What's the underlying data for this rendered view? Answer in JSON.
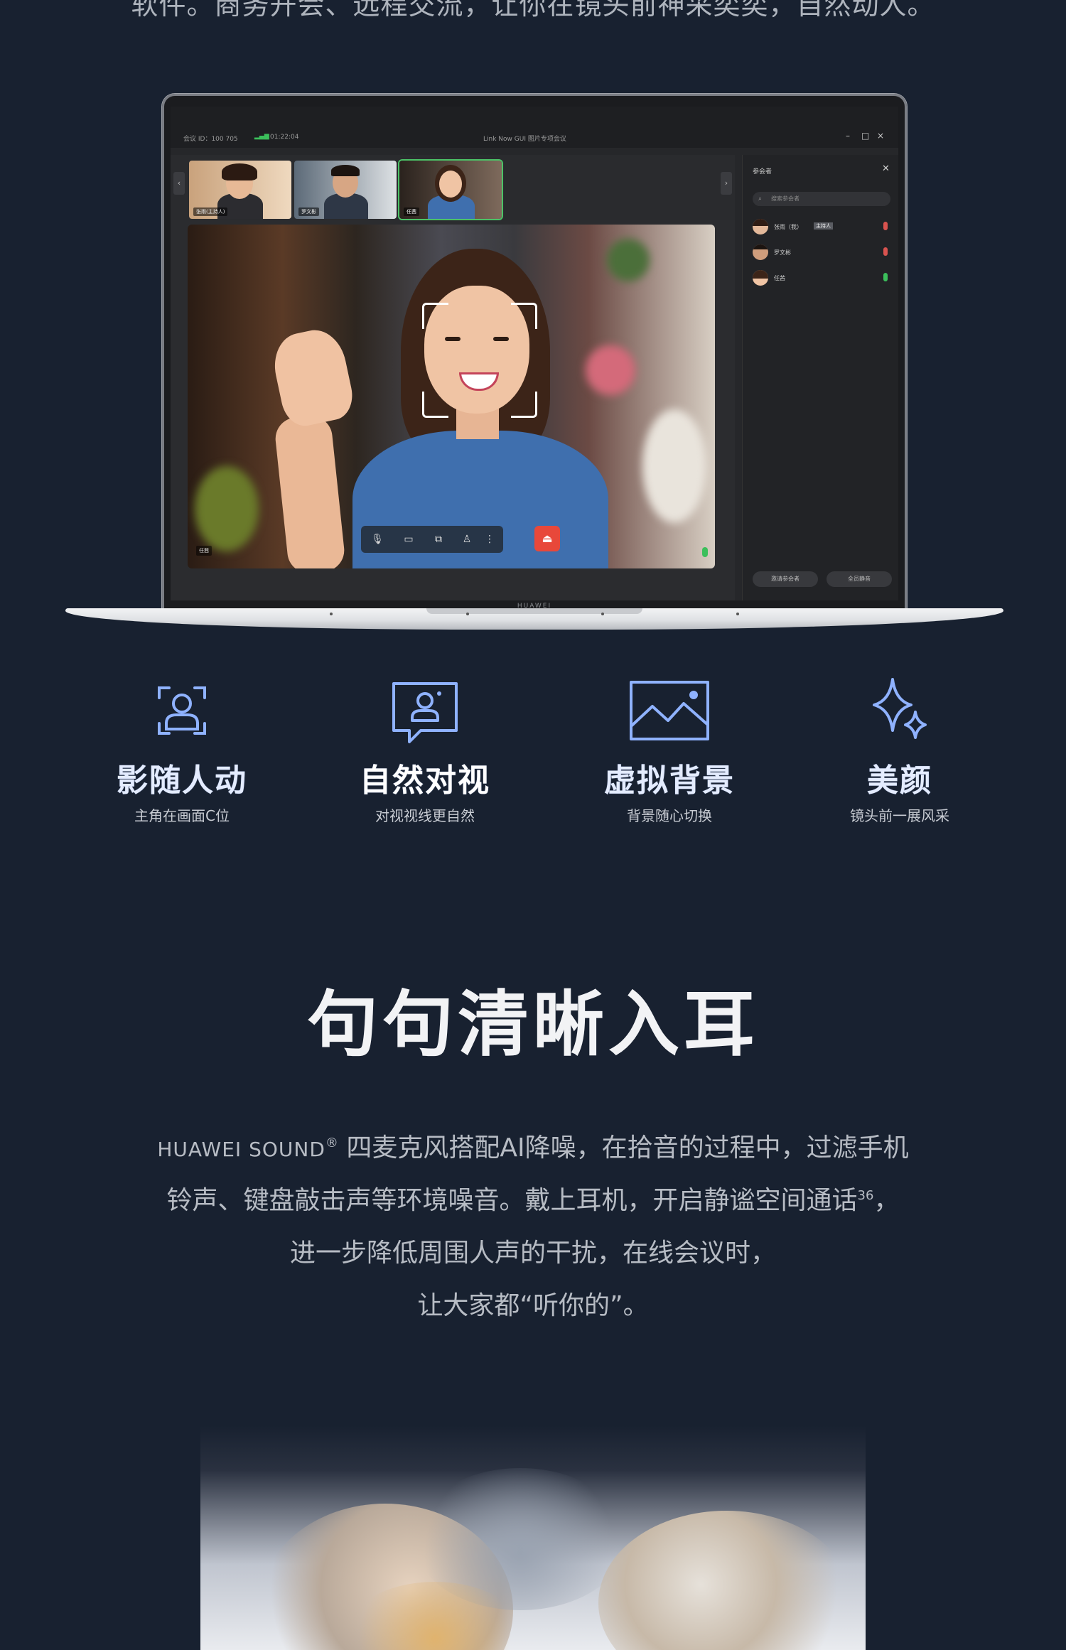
{
  "intro_text": "软件。商务开会、远程交流，让你在镜头前神采奕奕，自然动人。",
  "meeting_app": {
    "meeting_id": "会议 ID：100 705",
    "duration": "01:22:04",
    "title": "Link Now GUI 图片专项会议",
    "window_controls": [
      "–",
      "□",
      "×"
    ],
    "thumbnails": [
      {
        "label": "张雨(主持人)"
      },
      {
        "label": "罗文彬"
      },
      {
        "label": "任茜"
      }
    ],
    "main_video_label": "任茜",
    "participants_panel": {
      "title": "参会者",
      "search_placeholder": "搜索参会者",
      "participants": [
        {
          "name": "张雨（我）",
          "badge": "主持人",
          "mic": "red"
        },
        {
          "name": "罗文彬",
          "badge": "",
          "mic": "red"
        },
        {
          "name": "任茜",
          "badge": "",
          "mic": "green"
        }
      ],
      "invite_label": "邀请参会者",
      "mute_all_label": "全员静音"
    },
    "brand": "HUAWEI"
  },
  "features": [
    {
      "icon": "person-track-icon",
      "title": "影随人动",
      "subtitle": "主角在画面C位"
    },
    {
      "icon": "eye-contact-icon",
      "title": "自然对视",
      "subtitle": "对视视线更自然"
    },
    {
      "icon": "virtual-background-icon",
      "title": "虚拟背景",
      "subtitle": "背景随心切换"
    },
    {
      "icon": "sparkle-icon",
      "title": "美颜",
      "subtitle": "镜头前一展风采"
    }
  ],
  "section": {
    "heading": "句句清晰入耳",
    "brand_word": "HUAWEI SOUND",
    "brand_mark": "®",
    "line1_rest": " 四麦克风搭配AI降噪，在拾音的过程中，过滤手机",
    "line2": "铃声、键盘敲击声等环境噪音。戴上耳机，开启静谧空间通话",
    "line2_sup": "36",
    "line2_end": "，",
    "line3": "进一步降低周围人声的干扰，在线会议时，",
    "line4": "让大家都“听你的”。"
  },
  "colors": {
    "page_bg": "#182130",
    "accent_blue": "#8fb2ff",
    "end_call_red": "#e8483a",
    "mic_green": "#3bbf5b"
  }
}
